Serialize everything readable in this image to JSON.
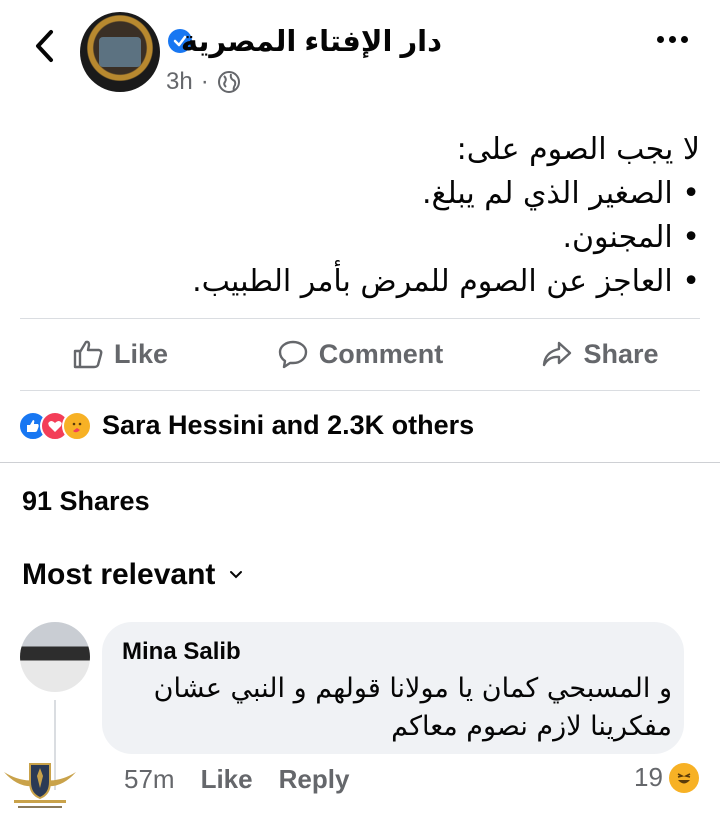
{
  "post": {
    "page_name": "دار الإفتاء المصرية",
    "time": "3h",
    "separator": "·",
    "lines": [
      "لا يجب الصوم على:",
      "الصغير الذي لم يبلغ.",
      "المجنون.",
      "العاجز عن الصوم للمرض بأمر الطبيب."
    ]
  },
  "actions": {
    "like": "Like",
    "comment": "Comment",
    "share": "Share"
  },
  "reactions": {
    "summary": "Sara Hessini and 2.3K others"
  },
  "shares": "91 Shares",
  "sort": "Most relevant",
  "comment": {
    "author": "Mina Salib",
    "lines": [
      "و المسبحي كمان يا مولانا قولهم و النبي عشان",
      "مفكرينا لازم نصوم معاكم"
    ],
    "time": "57m",
    "like": "Like",
    "reply": "Reply",
    "reaction_count": "19"
  },
  "colors": {
    "accent": "#1877f2",
    "secondary_text": "#65676b",
    "bubble": "#f0f2f5"
  },
  "icons": {
    "back": "chevron-left-icon",
    "verified": "verified-badge-icon",
    "audience": "globe-icon",
    "more": "more-dots-icon",
    "like": "thumbs-up-icon",
    "comment": "comment-bubble-icon",
    "share": "share-arrow-icon",
    "sort": "chevron-down-icon",
    "haha": "haha-emoji-icon"
  }
}
